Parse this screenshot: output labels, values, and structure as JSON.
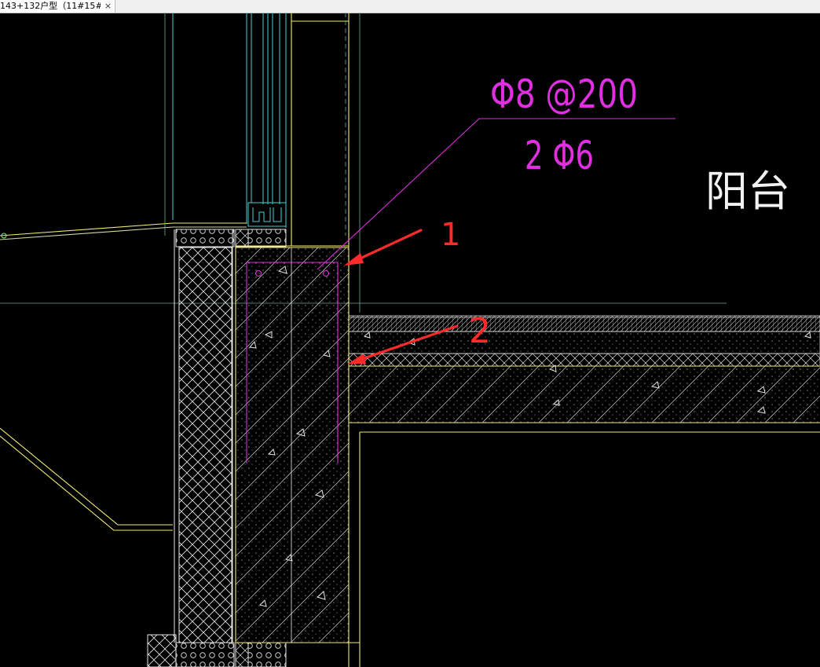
{
  "tab": {
    "title": "143+132户型（11#15#…",
    "close_glyph": "×"
  },
  "drawing": {
    "rebar_top": "Φ8 @200",
    "rebar_bottom": "2 Φ6",
    "room_label": "阳台",
    "marker_1": "1",
    "marker_2": "2"
  },
  "colors": {
    "background": "#000000",
    "wall_line": "#f4ec6e",
    "window_line": "#3fd4d4",
    "rebar_magenta": "#e02fe0",
    "hatch": "#e8e8e8",
    "annotation_red": "#ff2a2a",
    "axis_line": "#6fa9a0"
  }
}
